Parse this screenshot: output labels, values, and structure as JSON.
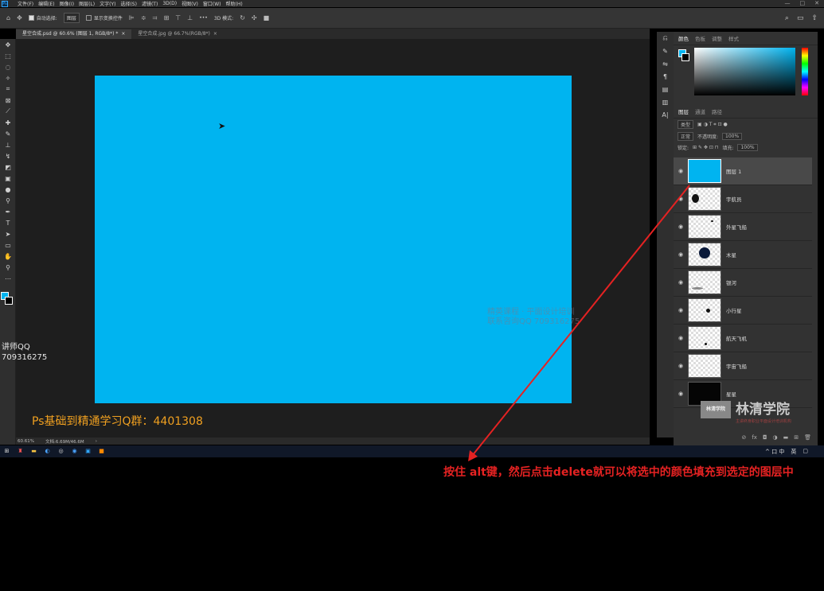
{
  "app": {
    "logo_text": "Ps"
  },
  "menu": [
    "文件(F)",
    "编辑(E)",
    "图像(I)",
    "图层(L)",
    "文字(Y)",
    "选择(S)",
    "滤镜(T)",
    "3D(D)",
    "视图(V)",
    "窗口(W)",
    "帮助(H)"
  ],
  "window_controls": [
    "—",
    "□",
    "✕"
  ],
  "options_bar": {
    "auto_select_label": "自动选择:",
    "auto_select_value": "图层",
    "show_transform_label": "显示变换控件",
    "mode_3d_label": "3D 模式:",
    "more": "•••"
  },
  "tabs": [
    {
      "label": "星空合成.psd @ 60.6% (图层 1, RGB/8*) *",
      "close": "×"
    },
    {
      "label": "星空合成.jpg @ 66.7%(RGB/8*)",
      "close": "×"
    }
  ],
  "canvas": {
    "fill_color": "#00b4f0"
  },
  "watermark": [
    "精英课程 · 平面设计培训",
    "联系咨询QQ 709316275"
  ],
  "overlay": {
    "teacher_label": "讲师QQ",
    "teacher_qq": "709316275",
    "qq_group": "Ps基础到精通学习Q群：4401308"
  },
  "statusbar": {
    "zoom": "60.61%",
    "doc": "文档:6.69M/46.6M",
    "arrow": "›"
  },
  "panels": {
    "color_tabs": [
      "颜色",
      "色板",
      "调整",
      "样式"
    ],
    "layer_tabs": [
      "图层",
      "通道",
      "路径"
    ],
    "filter_kind": "类型",
    "blend_mode": "正常",
    "opacity_label": "不透明度:",
    "opacity_value": "100%",
    "lock_label": "锁定:",
    "fill_label": "填充:",
    "fill_value": "100%"
  },
  "layers": [
    {
      "name": "图层 1",
      "thumb": "fill",
      "selected": true
    },
    {
      "name": "宇航员",
      "thumb": "checker",
      "selected": false
    },
    {
      "name": "外星飞船",
      "thumb": "checker",
      "selected": false
    },
    {
      "name": "木星",
      "thumb": "checker",
      "selected": false
    },
    {
      "name": "银河",
      "thumb": "checker",
      "selected": false
    },
    {
      "name": "小行星",
      "thumb": "checker",
      "selected": false
    },
    {
      "name": "航天飞机",
      "thumb": "checker",
      "selected": false
    },
    {
      "name": "宇宙飞船",
      "thumb": "checker",
      "selected": false
    },
    {
      "name": "星星",
      "thumb": "dark",
      "selected": false
    }
  ],
  "logo": {
    "name": "林清学院",
    "mark": "林清学院",
    "tagline": "主讲终身职业平面设计培训机构"
  },
  "taskbar": {
    "tray_ime": "英",
    "tray_time_icons": "^ 口 中"
  },
  "annotation": {
    "text": "按住 alt键，然后点击delete就可以将选中的颜色填充到选定的图层中",
    "color": "#e52222"
  },
  "colors": {
    "accent": "#00b4f0",
    "qq_group_color": "#f0a020"
  }
}
